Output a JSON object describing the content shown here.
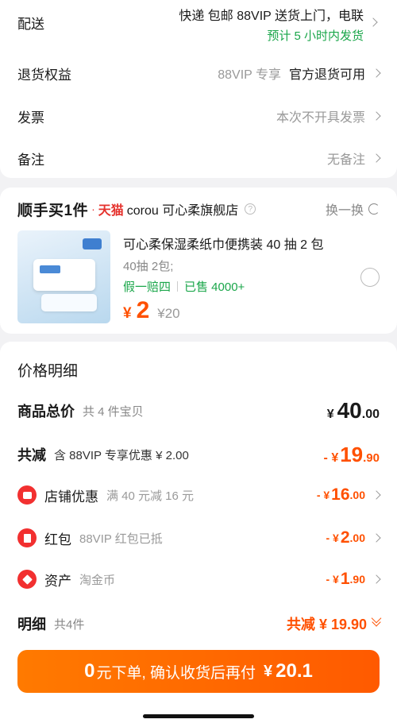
{
  "delivery": {
    "label": "配送",
    "line1": "快递 包邮 88VIP 送货上门，电联",
    "line2": "预计 5 小时内发货"
  },
  "return_rights": {
    "label": "退货权益",
    "tag": "88VIP 专享",
    "value": "官方退货可用"
  },
  "invoice": {
    "label": "发票",
    "value": "本次不开具发票"
  },
  "remark": {
    "label": "备注",
    "value": "无备注"
  },
  "store": {
    "brand": "顺手买1件",
    "dot": "·",
    "platform": "天猫",
    "name": "corou 可心柔旗舰店",
    "help": "?",
    "swap_label": "换一换"
  },
  "product": {
    "title": "可心柔保湿柔纸巾便携装 40 抽 2 包",
    "spec": "40抽 2包;",
    "tag": "假一赔四",
    "sold": "已售 4000+",
    "currency": "¥",
    "price": "2",
    "original_price": "¥20"
  },
  "price_detail": {
    "title": "价格明细",
    "goods_total": {
      "label": "商品总价",
      "sub": "共 4 件宝贝",
      "currency": "¥",
      "integer": "40",
      "decimal": ".00"
    },
    "reduction": {
      "label": "共减",
      "sub": "含 88VIP 专享优惠 ¥ 2.00",
      "prefix": "- ¥",
      "integer": "19",
      "decimal": ".90"
    },
    "store_discount": {
      "label": "店铺优惠",
      "sub": "满 40 元减 16 元",
      "prefix": "- ¥",
      "integer": "16",
      "decimal": ".00"
    },
    "red_packet": {
      "label": "红包",
      "sub": "88VIP 红包已抵",
      "prefix": "- ¥",
      "integer": "2",
      "decimal": ".00"
    },
    "assets": {
      "label": "资产",
      "sub": "淘金币",
      "prefix": "- ¥",
      "integer": "1",
      "decimal": ".90"
    },
    "detail": {
      "label": "明细",
      "sub": "共4件",
      "total": "共减 ¥ 19.90"
    }
  },
  "checkout": {
    "zero": "0",
    "text": "元下单, 确认收货后再付",
    "currency": "¥",
    "amount": "20.1"
  },
  "colors": {
    "accent": "#ff5000",
    "green": "#1aa64a",
    "tmall_red": "#e5322d",
    "icon_red": "#f23030"
  }
}
